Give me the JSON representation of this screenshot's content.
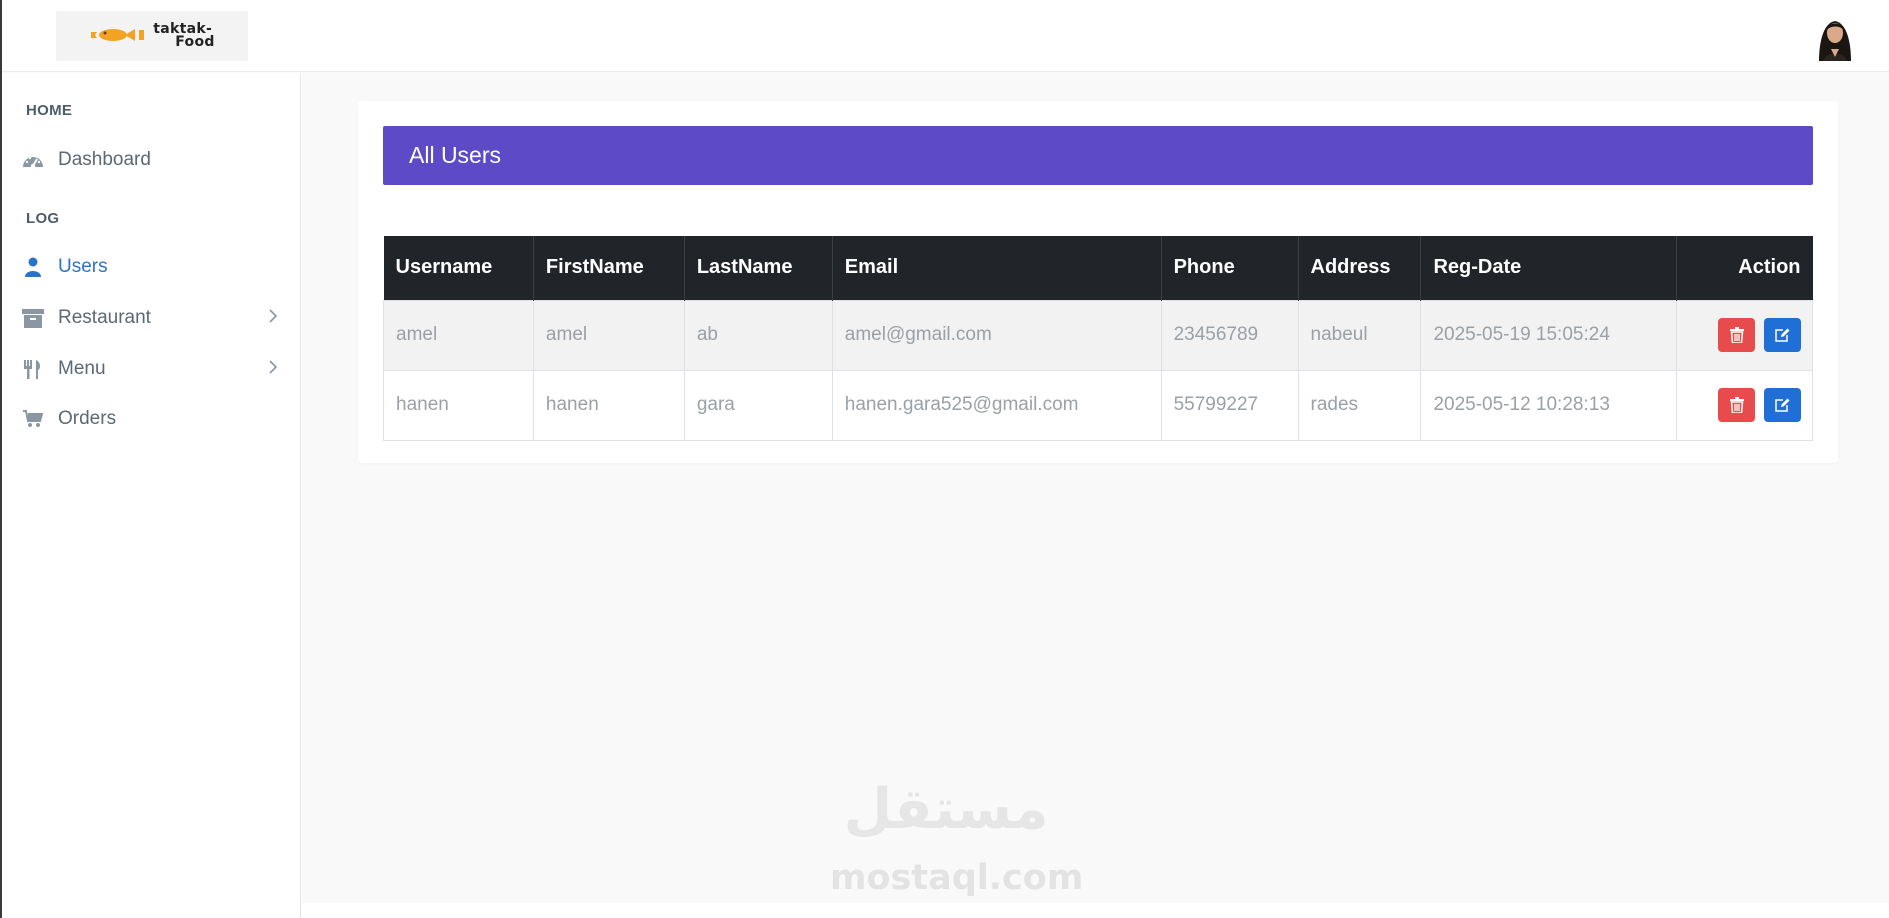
{
  "header": {
    "logo_text_line1": "taktak-",
    "logo_text_line2": "Food"
  },
  "sidebar": {
    "sections": [
      {
        "heading": "HOME"
      },
      {
        "heading": "LOG"
      }
    ],
    "items": [
      {
        "label": "Dashboard",
        "icon": "dashboard-icon"
      },
      {
        "label": "Users",
        "icon": "user-icon",
        "active": true
      },
      {
        "label": "Restaurant",
        "icon": "archive-icon",
        "has_submenu": true
      },
      {
        "label": "Menu",
        "icon": "cutlery-icon",
        "has_submenu": true
      },
      {
        "label": "Orders",
        "icon": "cart-icon"
      }
    ]
  },
  "card": {
    "title": "All Users",
    "columns": [
      "Username",
      "FirstName",
      "LastName",
      "Email",
      "Phone",
      "Address",
      "Reg-Date",
      "Action"
    ],
    "rows": [
      {
        "username": "amel",
        "firstname": "amel",
        "lastname": "ab",
        "email": "amel@gmail.com",
        "phone": "23456789",
        "address": "nabeul",
        "regdate": "2025-05-19 15:05:24"
      },
      {
        "username": "hanen",
        "firstname": "hanen",
        "lastname": "gara",
        "email": "hanen.gara525@gmail.com",
        "phone": "55799227",
        "address": "rades",
        "regdate": "2025-05-12 10:28:13"
      }
    ],
    "actions": {
      "delete_icon": "trash-icon",
      "edit_icon": "edit-icon"
    }
  },
  "colors": {
    "accent": "#5c4ac7",
    "table_header": "#212529",
    "delete": "#e84b4b",
    "edit": "#1f6fd6",
    "active_nav": "#2a74c7"
  },
  "watermark": {
    "arabic": "مستقل",
    "latin": "mostaql.com"
  }
}
